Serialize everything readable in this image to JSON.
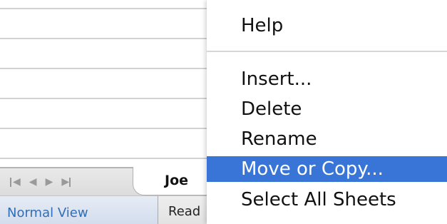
{
  "sheet_tabs": {
    "nav_icons": [
      "first-sheet-icon",
      "previous-sheet-icon",
      "next-sheet-icon",
      "last-sheet-icon"
    ],
    "active_tab": "Joe"
  },
  "status_bar": {
    "view_button": "Normal View",
    "status_text": "Read"
  },
  "context_menu": {
    "items": [
      {
        "label": "Help"
      },
      {
        "label": "Insert..."
      },
      {
        "label": "Delete"
      },
      {
        "label": "Rename"
      },
      {
        "label": "Move or Copy...",
        "selected": true
      },
      {
        "label": "Select All Sheets"
      }
    ],
    "highlight_color": "#3875d7"
  }
}
